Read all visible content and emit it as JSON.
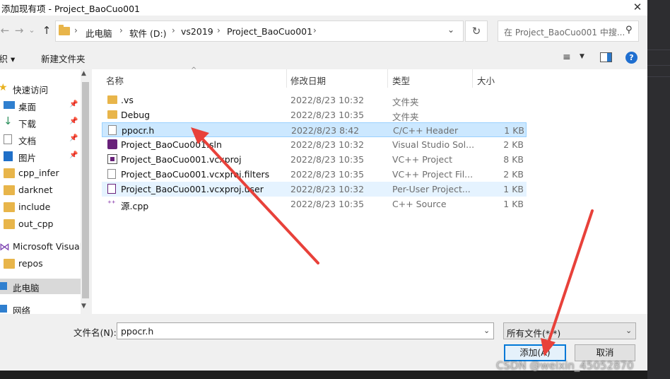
{
  "window": {
    "title": "添加现有项 - Project_BaoCuo001",
    "close_glyph": "✕"
  },
  "nav": {
    "back": "←",
    "forward": "→",
    "dropdown": "⌄",
    "up": "↑",
    "breadcrumbs": [
      "此电脑",
      "软件 (D:)",
      "vs2019",
      "Project_BaoCuo001"
    ],
    "refresh": "↻",
    "search_placeholder": "在 Project_BaoCuo001 中搜...",
    "search_icon": "search-icon"
  },
  "toolbar": {
    "organize": "组织 ▾",
    "new_folder": "新建文件夹",
    "view_icon": "≡",
    "help": "?"
  },
  "sidebar": {
    "items": [
      {
        "label": "快速访问",
        "icon": "star-icon"
      },
      {
        "label": "桌面",
        "icon": "desktop-icon",
        "pinned": true
      },
      {
        "label": "下载",
        "icon": "download-icon",
        "pinned": true
      },
      {
        "label": "文档",
        "icon": "document-icon",
        "pinned": true
      },
      {
        "label": "图片",
        "icon": "pictures-icon",
        "pinned": true
      },
      {
        "label": "cpp_infer",
        "icon": "folder-icon"
      },
      {
        "label": "darknet",
        "icon": "folder-icon"
      },
      {
        "label": "include",
        "icon": "folder-icon"
      },
      {
        "label": "out_cpp",
        "icon": "folder-icon"
      },
      {
        "label": "Microsoft Visual",
        "icon": "visual-studio-icon"
      },
      {
        "label": "repos",
        "icon": "folder-icon"
      },
      {
        "label": "此电脑",
        "icon": "computer-icon",
        "selected": true
      },
      {
        "label": "网络",
        "icon": "network-icon"
      }
    ]
  },
  "columns": [
    "名称",
    "修改日期",
    "类型",
    "大小"
  ],
  "files": [
    {
      "name": ".vs",
      "date": "2022/8/23 10:32",
      "type": "文件夹",
      "size": "",
      "icon": "folder-icon"
    },
    {
      "name": "Debug",
      "date": "2022/8/23 10:35",
      "type": "文件夹",
      "size": "",
      "icon": "folder-icon"
    },
    {
      "name": "ppocr.h",
      "date": "2022/8/23 8:42",
      "type": "C/C++ Header",
      "size": "1 KB",
      "icon": "header-file-icon",
      "selected": true
    },
    {
      "name": "Project_BaoCuo001.sln",
      "date": "2022/8/23 10:32",
      "type": "Visual Studio Sol...",
      "size": "2 KB",
      "icon": "solution-file-icon"
    },
    {
      "name": "Project_BaoCuo001.vcxproj",
      "date": "2022/8/23 10:35",
      "type": "VC++ Project",
      "size": "8 KB",
      "icon": "vcxproj-file-icon"
    },
    {
      "name": "Project_BaoCuo001.vcxproj.filters",
      "date": "2022/8/23 10:35",
      "type": "VC++ Project Fil...",
      "size": "2 KB",
      "icon": "filters-file-icon"
    },
    {
      "name": "Project_BaoCuo001.vcxproj.user",
      "date": "2022/8/23 10:32",
      "type": "Per-User Project...",
      "size": "1 KB",
      "icon": "user-file-icon",
      "hover": true
    },
    {
      "name": "源.cpp",
      "date": "2022/8/23 10:35",
      "type": "C++ Source",
      "size": "1 KB",
      "icon": "cpp-file-icon"
    }
  ],
  "footer": {
    "filename_label": "文件名(N):",
    "filename_value": "ppocr.h",
    "filter_value": "所有文件(*.*)",
    "add_button": "添加(A)",
    "cancel_button": "取消"
  },
  "annotation_color": "#e8413a",
  "watermark": "CSDN @weixin_45052870"
}
